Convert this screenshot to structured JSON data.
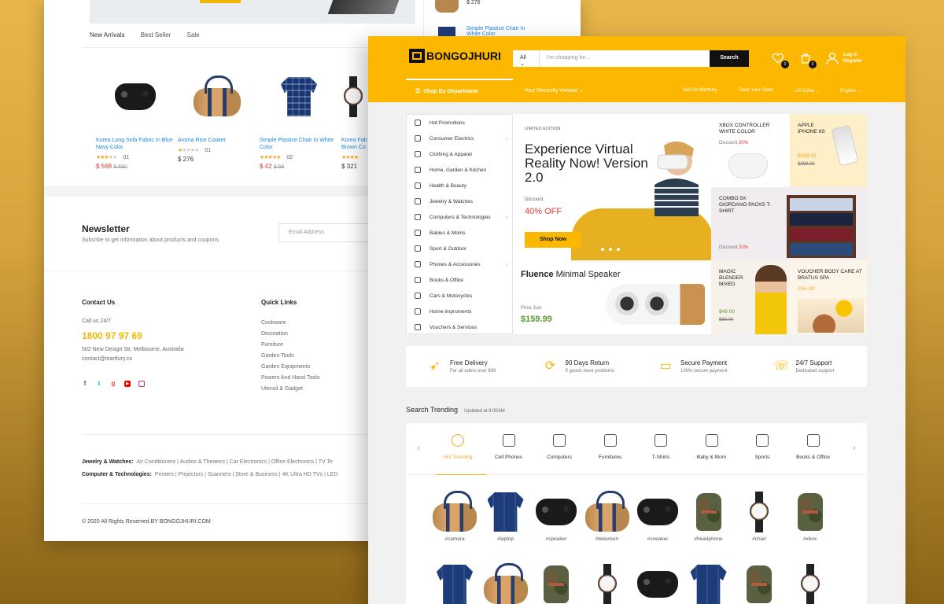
{
  "back": {
    "tabs": [
      "New Arrivals",
      "Best Seller",
      "Sale"
    ],
    "products": [
      {
        "title": "Korea Long Sofa Fabric In Blue Navy Color",
        "stars": 3,
        "count": "01",
        "price": "$ 568",
        "old": "$ 680",
        "sale": true
      },
      {
        "title": "Aroma Rice Cooker",
        "stars": 1,
        "count": "01",
        "price": "$ 276",
        "old": "",
        "sale": false
      },
      {
        "title": "Simple Plastice Chair In White Color",
        "stars": 5,
        "count": "02",
        "price": "$ 42",
        "old": "$ 56",
        "sale": true
      },
      {
        "title": "Korea Fab Brown Co",
        "stars": 4,
        "count": "",
        "price": "$ 321",
        "old": "",
        "sale": false
      }
    ],
    "side_price": "$ 276",
    "side_title": "Simple Plastice Chair In White Color",
    "newsletter": {
      "title": "Newsletter",
      "subtitle": "Subcribe to get information about products and coupons",
      "placeholder": "Email Address"
    },
    "contact": {
      "heading": "Contact Us",
      "call": "Call us 24/7",
      "phone": "1800 97 97 69",
      "address": "502 New Design Str, Melbourne, Australia",
      "email": "contact@martfury.co"
    },
    "quick_links": {
      "heading": "Quick Links",
      "items": [
        "Cookware",
        "Decoration",
        "Furniture",
        "Garden Tools",
        "Garden Equipments",
        "Powers And Hand Tools",
        "Utensil & Gadget"
      ]
    },
    "cat_rows": [
      {
        "label": "Jewelry & Watches:",
        "items": "Air Conditioners  |  Audios & Theaters  |  Car Electronics  |  Office Electronics  |  TV Te"
      },
      {
        "label": "Computer & Technologies:",
        "items": "Printers  |  Projectors  |  Scanners  |  Store & Business  |  4K Ultra HD TVs  |  LED"
      }
    ],
    "copyright": "© 2020 All Rights Reserved BY BONGOJHURI.COM",
    "social_icons": [
      "facebook-icon",
      "twitter-icon",
      "google-plus-icon",
      "youtube-icon",
      "instagram-icon"
    ]
  },
  "header": {
    "logo": "BONGOJHURI",
    "search": {
      "category": "All",
      "placeholder": "I'm shopping for...",
      "button": "Search"
    },
    "wishlist_count": "0",
    "cart_count": "0",
    "login": "Log In",
    "register": "Register",
    "nav": {
      "dept": "Shop By Department",
      "recent": "Your Recently Viewed",
      "sell": "Sell On Martfury",
      "track": "Track Your Order",
      "currency": "US Dollar",
      "language": "English"
    }
  },
  "menu": [
    "Hot Promotions",
    "Consumer Electrics",
    "Clothing & Apparel",
    "Home, Garden & Kitchen",
    "Health & Beauty",
    "Jewelry & Watches",
    "Computers & Technologies",
    "Babies & Moms",
    "Sport & Outdoor",
    "Phones & Accessories",
    "Books & Office",
    "Cars & Motocycles",
    "Home Improments",
    "Vouchers & Services"
  ],
  "hero": {
    "edition": "LIMITED EDITION",
    "headline": "Experience Virtual Reality Now! Version 2.0",
    "discount_label": "Discount",
    "discount": "40% OFF",
    "button": "Shop Now"
  },
  "tiles": {
    "xbox": {
      "title": "XBOX CONTROLLER WHITE COLOR",
      "disc_label": "Discount",
      "disc": "30%"
    },
    "apple": {
      "title": "APPLE IPHONE 6S",
      "price": "$599.00",
      "old": "$899.00"
    },
    "combo": {
      "title": "COMBO 5X GIORDANO PACKS T-SHIRT",
      "disc_label": "Discount",
      "disc": "20%"
    },
    "fluence": {
      "brand": "Fluence",
      "name": "Minimal Speaker",
      "price_label": "Price Just",
      "price": "$159.99"
    },
    "blender": {
      "title": "MAGIC BLENDER MIXED",
      "price": "$49.00",
      "old": "$69.00"
    },
    "voucher": {
      "title": "VOUCHER BODY CARE AT BRATUS SPA",
      "off": "25% Off"
    }
  },
  "features": [
    {
      "title": "Free Delivery",
      "sub": "For all oders over $99",
      "icon": "rocket-icon"
    },
    {
      "title": "90 Days Return",
      "sub": "If goods have problems",
      "icon": "refresh-icon"
    },
    {
      "title": "Secure Payment",
      "sub": "100% secure payment",
      "icon": "credit-card-icon"
    },
    {
      "title": "24/7 Support",
      "sub": "Dedicated support",
      "icon": "chat-icon"
    }
  ],
  "trending": {
    "title": "Search Trending",
    "updated": "Updated at 9:00AM",
    "tabs": [
      "Hot Trending",
      "Cell Phones",
      "Computers",
      "Furnitures",
      "T-Shirts",
      "Baby & Mom",
      "Sports",
      "Books & Office"
    ],
    "tags": [
      "#camera",
      "#laptop",
      "#speaker",
      "#televison",
      "#sneaker",
      "#headphone",
      "#chair",
      "#xbox"
    ]
  }
}
